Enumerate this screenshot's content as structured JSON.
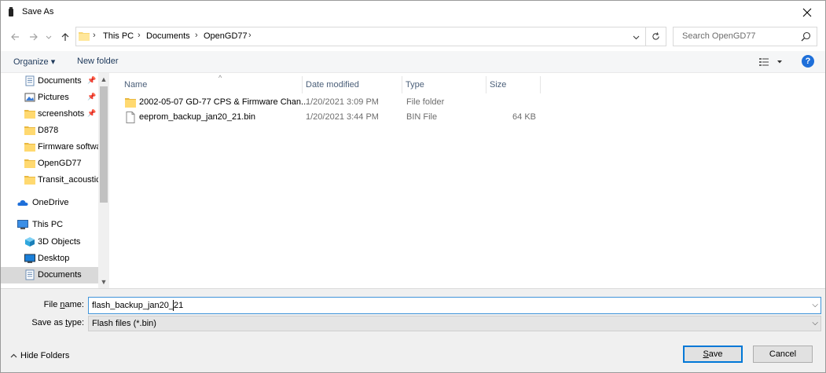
{
  "window": {
    "title": "Save As"
  },
  "address": {
    "crumbs": [
      "This PC",
      "Documents",
      "OpenGD77"
    ],
    "search_placeholder": "Search OpenGD77"
  },
  "toolbar": {
    "organize": "Organize ▾",
    "new_folder": "New folder",
    "help": "?"
  },
  "sidebar": {
    "items": [
      {
        "label": "Documents",
        "icon": "documents-icon",
        "pinned": true
      },
      {
        "label": "Pictures",
        "icon": "pictures-icon",
        "pinned": true
      },
      {
        "label": "screenshots",
        "icon": "folder-icon",
        "pinned": true
      },
      {
        "label": "D878",
        "icon": "folder-icon"
      },
      {
        "label": "Firmware softwa",
        "icon": "folder-icon"
      },
      {
        "label": "OpenGD77",
        "icon": "folder-icon"
      },
      {
        "label": "Transit_acoustic",
        "icon": "folder-icon"
      },
      {
        "label": "OneDrive",
        "icon": "onedrive-icon"
      },
      {
        "label": "This PC",
        "icon": "pc-icon"
      },
      {
        "label": "3D Objects",
        "icon": "3d-objects-icon"
      },
      {
        "label": "Desktop",
        "icon": "desktop-icon"
      },
      {
        "label": "Documents",
        "icon": "documents-icon",
        "selected": true
      }
    ]
  },
  "filelist": {
    "columns": [
      "Name",
      "Date modified",
      "Type",
      "Size"
    ],
    "rows": [
      {
        "name": "2002-05-07 GD-77 CPS & Firmware Chan...",
        "date": "1/20/2021 3:09 PM",
        "type": "File folder",
        "size": "",
        "icon": "folder-icon"
      },
      {
        "name": "eeprom_backup_jan20_21.bin",
        "date": "1/20/2021 3:44 PM",
        "type": "BIN File",
        "size": "64 KB",
        "icon": "file-icon"
      }
    ]
  },
  "form": {
    "file_name_label_pre": "File ",
    "file_name_label_ul": "n",
    "file_name_label_post": "ame:",
    "file_name_value": "flash_backup_jan20_21",
    "save_type_label_pre": "Save as ",
    "save_type_label_ul": "t",
    "save_type_label_post": "ype:",
    "save_type_value": "Flash files (*.bin)",
    "hide_folders": "Hide Folders",
    "save_pre": "",
    "save_ul": "S",
    "save_post": "ave",
    "cancel": "Cancel"
  }
}
